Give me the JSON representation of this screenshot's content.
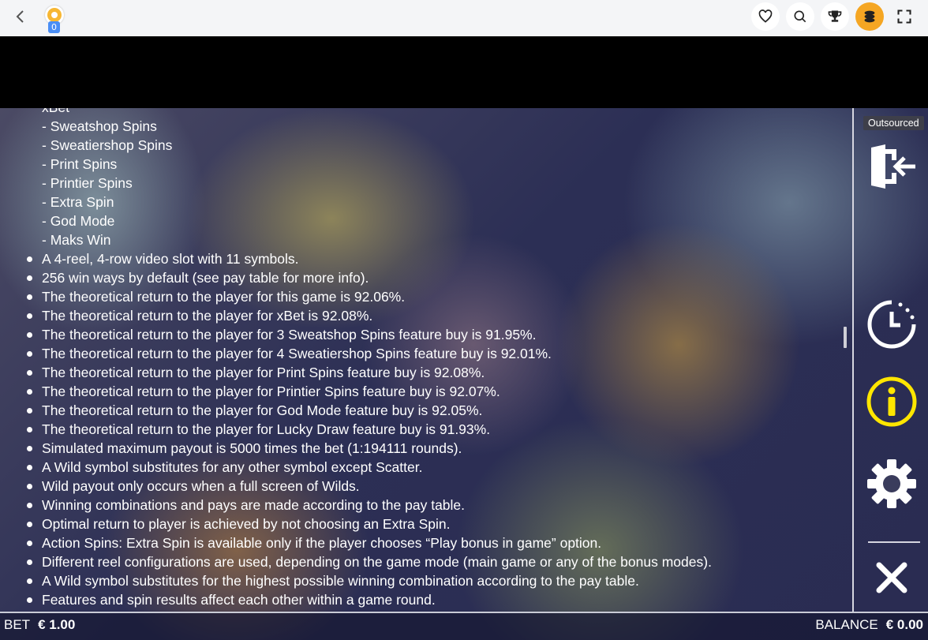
{
  "topbar": {
    "back_icon": "chevron-left-icon",
    "coin_count": "0",
    "icons": [
      "heart-icon",
      "search-icon",
      "trophy-icon",
      "coins-icon",
      "fullscreen-icon"
    ]
  },
  "content": {
    "partial_top_line": "xBet",
    "sub_items": [
      "- Sweatshop Spins",
      "- Sweatiershop Spins",
      "- Print Spins",
      "- Printier Spins",
      "- Extra Spin",
      "- God Mode",
      "- Maks Win"
    ],
    "bullets": [
      "A 4-reel, 4-row video slot with 11 symbols.",
      "256 win ways by default (see pay table for more info).",
      "The theoretical return to the player for this game is 92.06%.",
      "The theoretical return to the player for xBet is 92.08%.",
      "The theoretical return to the player for 3 Sweatshop Spins feature buy is 91.95%.",
      "The theoretical return to the player for 4 Sweatiershop Spins feature buy is 92.01%.",
      "The theoretical return to the player for Print Spins feature buy is 92.08%.",
      "The theoretical return to the player for Printier Spins feature buy is 92.07%.",
      "The theoretical return to the player for God Mode feature buy is 92.05%.",
      "The theoretical return to the player for Lucky Draw feature buy is 91.93%.",
      "Simulated maximum payout is 5000 times the bet (1:194111 rounds).",
      "A Wild symbol substitutes for any other symbol except Scatter.",
      "Wild payout only occurs when a full screen of Wilds.",
      "Winning combinations and pays are made according to the pay table.",
      "Optimal return to player is achieved by not choosing an Extra Spin.",
      "Action Spins: Extra Spin is available only if the player chooses “Play bonus in game” option.",
      "Different reel configurations are used, depending on the game mode (main game or any of the bonus modes).",
      "A Wild symbol substitutes for the highest possible winning combination according to the pay table.",
      "Features and spin results affect each other within a game round."
    ]
  },
  "sidebar": {
    "tooltip": "Outsourced",
    "buttons": [
      "exit-icon",
      "history-icon",
      "info-icon",
      "settings-icon",
      "close-icon"
    ],
    "accent_color": "#ffe600"
  },
  "footer": {
    "bet_label": "BET",
    "bet_value": "€ 1.00",
    "balance_label": "BALANCE",
    "balance_value": "€ 0.00"
  }
}
